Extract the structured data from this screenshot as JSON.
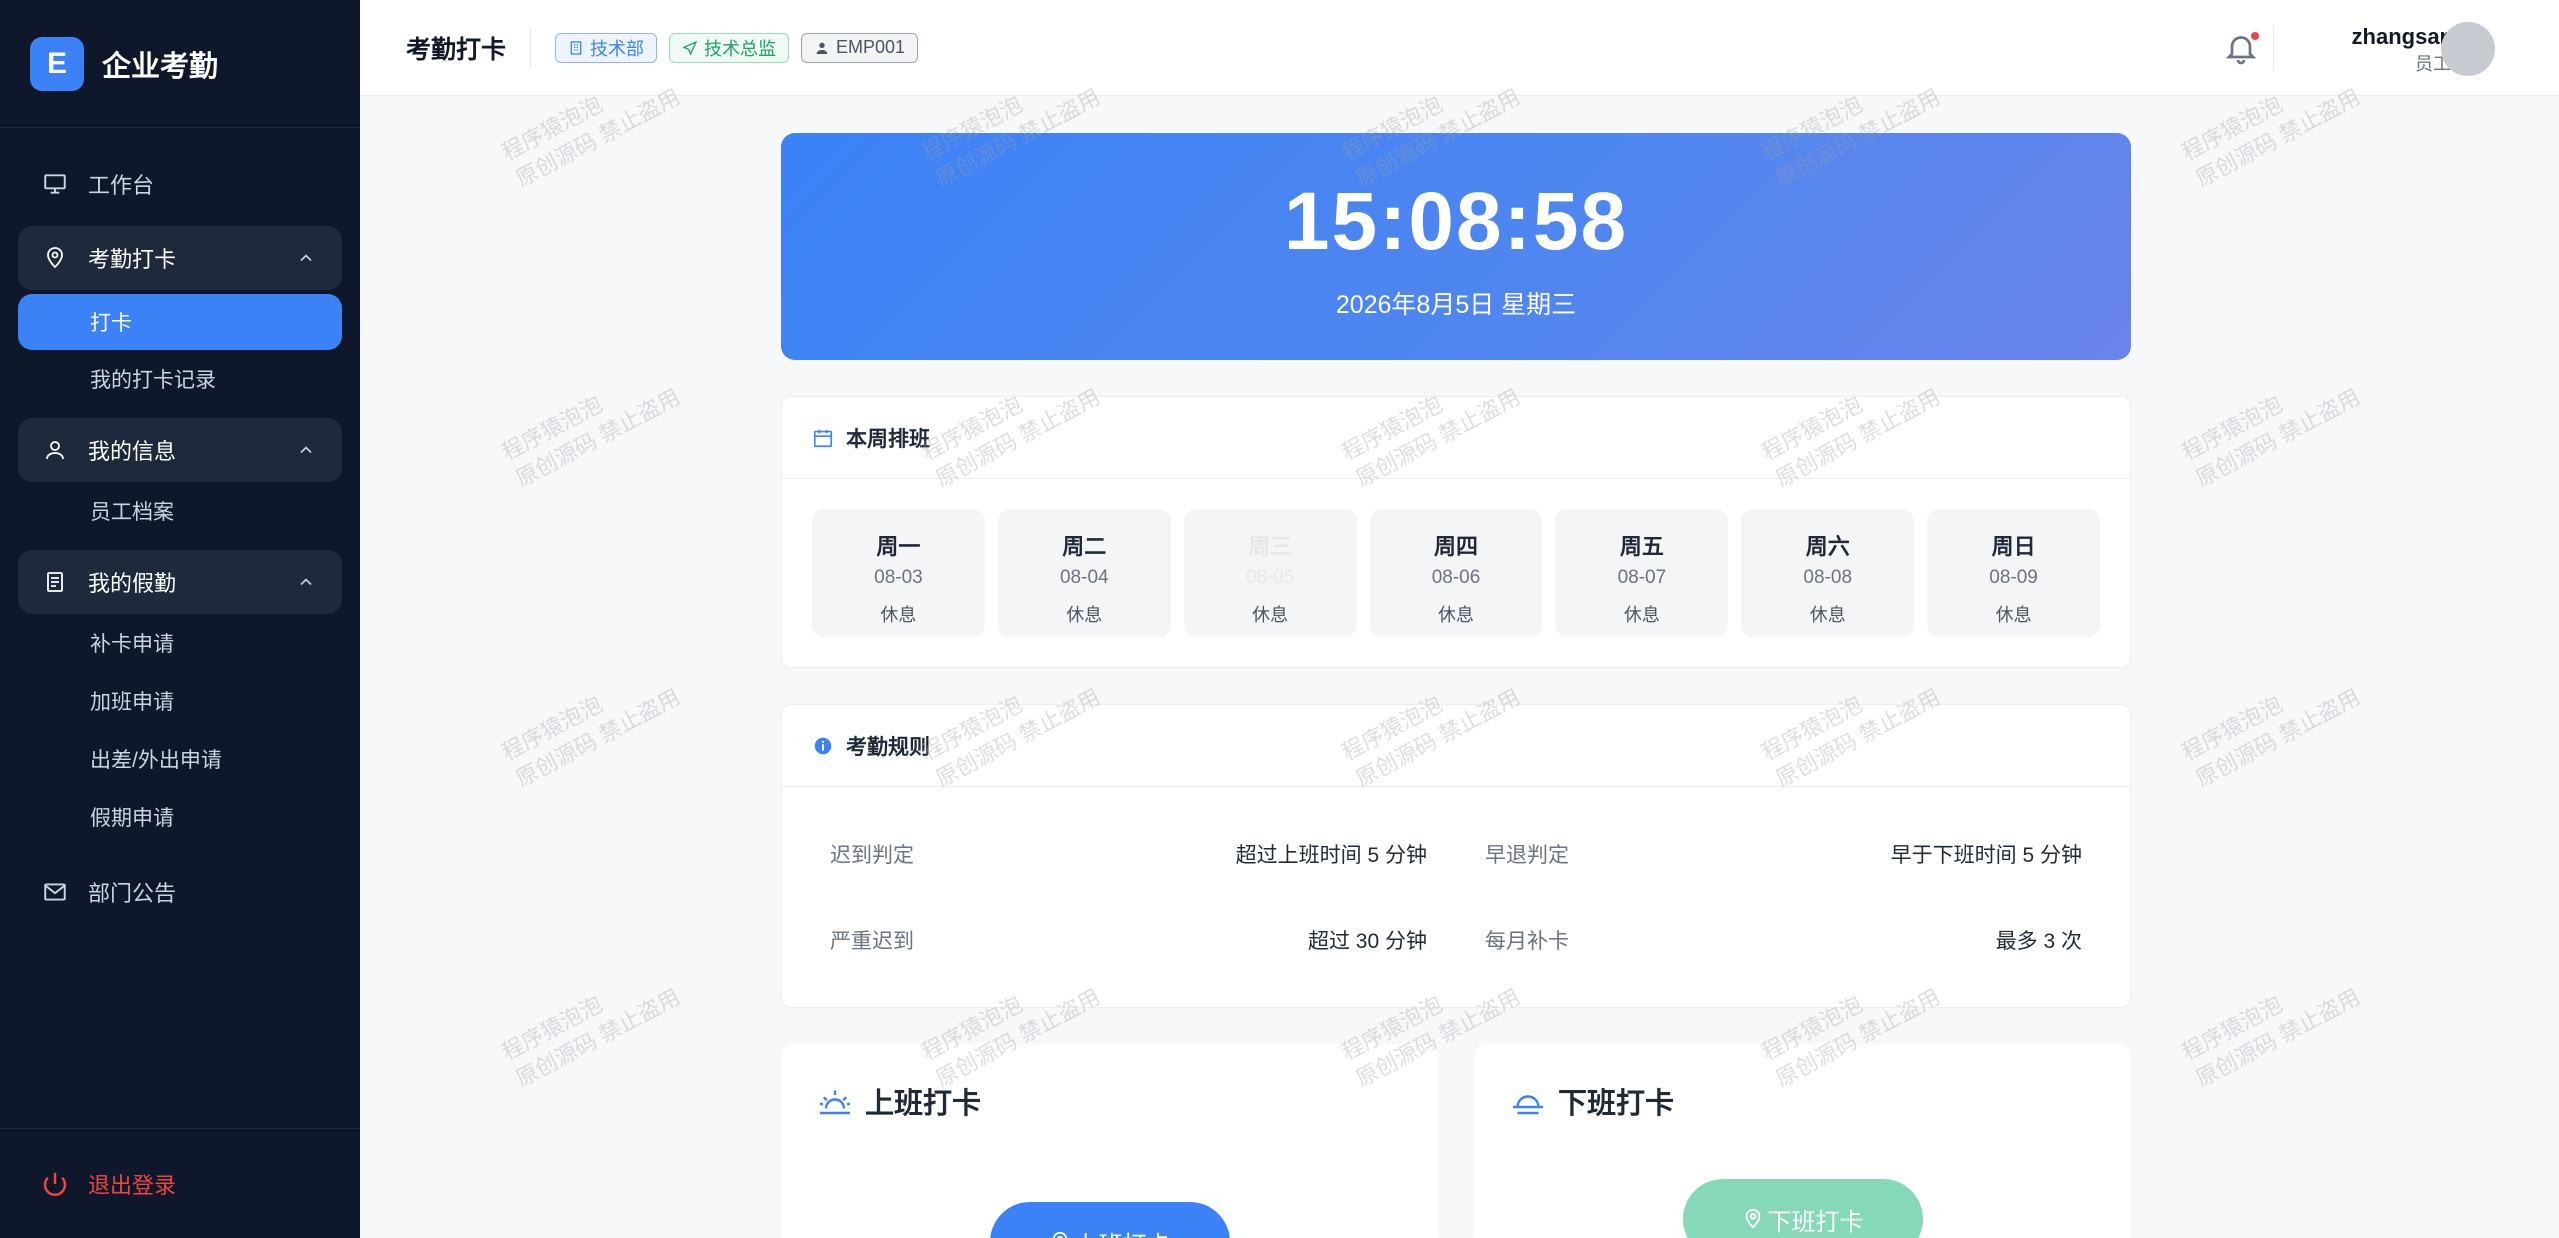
{
  "sidebar": {
    "brand_letter": "E",
    "brand_name": "企业考勤",
    "workbench": "工作台",
    "groups": [
      {
        "label": "考勤打卡",
        "items": [
          "打卡",
          "我的打卡记录"
        ]
      },
      {
        "label": "我的信息",
        "items": [
          "员工档案"
        ]
      },
      {
        "label": "我的假勤",
        "items": [
          "补卡申请",
          "加班申请",
          "出差/外出申请",
          "假期申请"
        ]
      }
    ],
    "notice": "部门公告",
    "logout": "退出登录"
  },
  "header": {
    "title": "考勤打卡",
    "tags": [
      "技术部",
      "技术总监",
      "EMP001"
    ],
    "user_name": "zhangsan",
    "user_role": "员工"
  },
  "clock": {
    "time": "15:08:58",
    "date": "2026年8月5日 星期三"
  },
  "schedule": {
    "title": "本周排班",
    "days": [
      {
        "name": "周一",
        "date": "08-03",
        "status": "休息"
      },
      {
        "name": "周二",
        "date": "08-04",
        "status": "休息"
      },
      {
        "name": "周三",
        "date": "08-05",
        "status": "休息"
      },
      {
        "name": "周四",
        "date": "08-06",
        "status": "休息"
      },
      {
        "name": "周五",
        "date": "08-07",
        "status": "休息"
      },
      {
        "name": "周六",
        "date": "08-08",
        "status": "休息"
      },
      {
        "name": "周日",
        "date": "08-09",
        "status": "休息"
      }
    ]
  },
  "rules": {
    "title": "考勤规则",
    "items": [
      {
        "label": "迟到判定",
        "value": "超过上班时间 5 分钟"
      },
      {
        "label": "早退判定",
        "value": "早于下班时间 5 分钟"
      },
      {
        "label": "严重迟到",
        "value": "超过 30 分钟"
      },
      {
        "label": "每月补卡",
        "value": "最多 3 次"
      }
    ]
  },
  "punch_in": {
    "title": "上班打卡",
    "button": "上班打卡"
  },
  "punch_out": {
    "title": "下班打卡",
    "button": "下班打卡"
  },
  "watermark": [
    "程序猿泡泡",
    "原创源码 禁止盗用"
  ],
  "colors": {
    "primary": "#3b82f6",
    "sidebar_bg": "#0f172a",
    "danger": "#ef4444",
    "success_light": "#86d9b8"
  }
}
